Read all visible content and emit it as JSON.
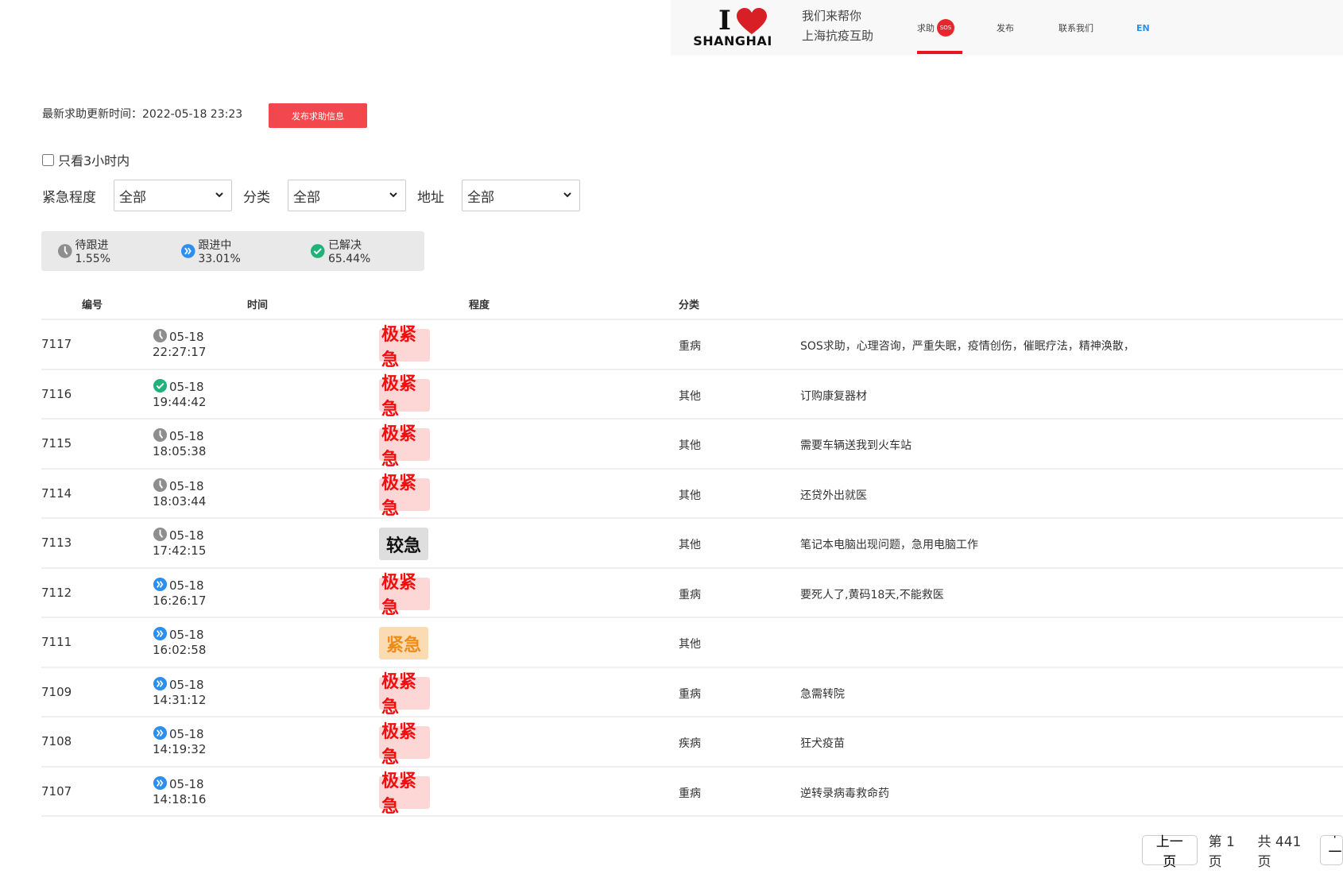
{
  "header": {
    "logo_letter": "I",
    "logo_city": "SHANGHAI",
    "slogan_line1": "我们来帮你",
    "slogan_line2": "上海抗疫互助",
    "nav": {
      "help": "求助",
      "sos_badge": "SOS",
      "publish": "发布",
      "contact": "联系我们",
      "language": "EN"
    },
    "active_nav": "help",
    "accent_color": "#e8161d"
  },
  "toolbar": {
    "update_time_label": "最新求助更新时间：2022-05-18 23:23",
    "publish_button": "发布求助信息"
  },
  "filters": {
    "only_3h_label": "只看3小时内",
    "only_3h_checked": false,
    "urgency_label": "紧急程度",
    "urgency_value": "全部",
    "category_label": "分类",
    "category_value": "全部",
    "address_label": "地址",
    "address_value": "全部"
  },
  "stats": {
    "pending": "待跟进1.55%",
    "in_progress": "跟进中33.01%",
    "resolved": "已解决65.44%"
  },
  "table": {
    "headers": {
      "id": "编号",
      "time": "时间",
      "level": "程度",
      "category": "分类"
    },
    "rows": [
      {
        "id": "7117",
        "status": "pending",
        "date": "05-18",
        "time": "22:27:17",
        "level": "极紧急",
        "level_type": "critical",
        "category": "重病",
        "desc": "SOS求助，心理咨询，严重失眠，疫情创伤，催眠疗法，精神涣散，"
      },
      {
        "id": "7116",
        "status": "resolved",
        "date": "05-18",
        "time": "19:44:42",
        "level": "极紧急",
        "level_type": "critical",
        "category": "其他",
        "desc": "订购康复器材"
      },
      {
        "id": "7115",
        "status": "pending",
        "date": "05-18",
        "time": "18:05:38",
        "level": "极紧急",
        "level_type": "critical",
        "category": "其他",
        "desc": "需要车辆送我到火车站"
      },
      {
        "id": "7114",
        "status": "pending",
        "date": "05-18",
        "time": "18:03:44",
        "level": "极紧急",
        "level_type": "critical",
        "category": "其他",
        "desc": "还贷外出就医"
      },
      {
        "id": "7113",
        "status": "pending",
        "date": "05-18",
        "time": "17:42:15",
        "level": "较急",
        "level_type": "high",
        "category": "其他",
        "desc": "笔记本电脑出现问题，急用电脑工作"
      },
      {
        "id": "7112",
        "status": "in_progress",
        "date": "05-18",
        "time": "16:26:17",
        "level": "极紧急",
        "level_type": "critical",
        "category": "重病",
        "desc": "要死人了,黄码18天,不能救医"
      },
      {
        "id": "7111",
        "status": "in_progress",
        "date": "05-18",
        "time": "16:02:58",
        "level": "紧急",
        "level_type": "medium",
        "category": "其他",
        "desc": ""
      },
      {
        "id": "7109",
        "status": "in_progress",
        "date": "05-18",
        "time": "14:31:12",
        "level": "极紧急",
        "level_type": "critical",
        "category": "重病",
        "desc": "急需转院"
      },
      {
        "id": "7108",
        "status": "in_progress",
        "date": "05-18",
        "time": "14:19:32",
        "level": "极紧急",
        "level_type": "critical",
        "category": "疾病",
        "desc": "狂犬疫苗"
      },
      {
        "id": "7107",
        "status": "in_progress",
        "date": "05-18",
        "time": "14:18:16",
        "level": "极紧急",
        "level_type": "critical",
        "category": "重病",
        "desc": "逆转录病毒救命药"
      }
    ]
  },
  "pagination": {
    "prev_label": "上一页",
    "current_page_text": "第 1 页",
    "total_pages_text": "共 441 页",
    "next_label": "下一页"
  },
  "colors": {
    "pending": "#8e8e8e",
    "in_progress": "#2b8ff0",
    "resolved": "#1fb37a",
    "critical_text": "#f00e0e",
    "critical_bg": "#fdd6d6",
    "medium_text": "#ef8c17",
    "medium_bg": "#fbdbb4",
    "high_bg": "#dedede"
  }
}
